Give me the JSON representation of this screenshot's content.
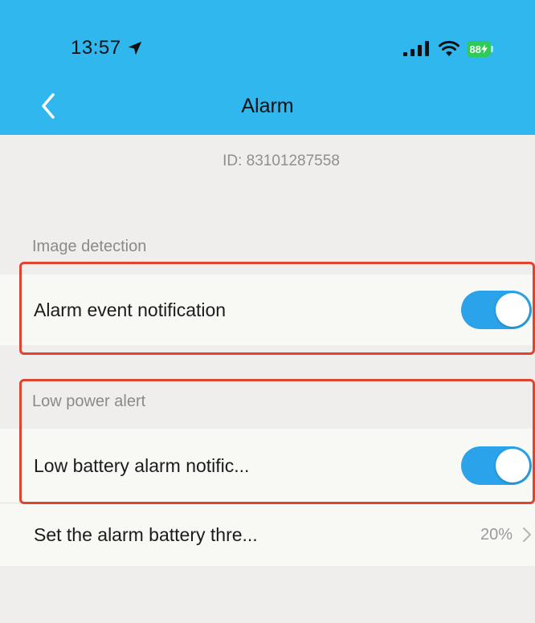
{
  "status_bar": {
    "time": "13:57",
    "battery": "88"
  },
  "nav": {
    "title": "Alarm"
  },
  "device": {
    "id_text": "ID: 83101287558"
  },
  "sections": {
    "image_detection": {
      "label": "Image detection",
      "alarm_event_notification": {
        "label": "Alarm event notification",
        "enabled": true
      }
    },
    "low_power": {
      "label": "Low power alert",
      "low_battery_notification": {
        "label": "Low battery alarm notific...",
        "enabled": true
      },
      "battery_threshold": {
        "label": "Set the alarm battery thre...",
        "value": "20%"
      }
    }
  },
  "colors": {
    "header": "#2fb7ee",
    "toggle_on": "#2ba3ea",
    "highlight": "#e0442e",
    "background": "#efeeec"
  },
  "icons": {
    "back": "chevron-left-icon",
    "location": "location-arrow-icon",
    "signal": "cellular-signal-icon",
    "wifi": "wifi-icon",
    "battery": "battery-charging-icon",
    "disclosure": "chevron-right-icon"
  }
}
